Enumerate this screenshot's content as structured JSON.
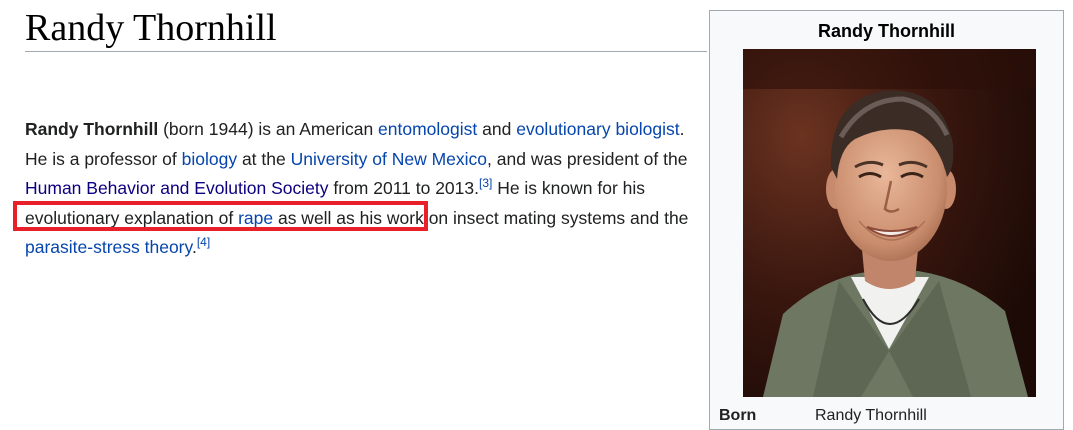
{
  "article": {
    "title": "Randy Thornhill",
    "lead": {
      "subject": "Randy Thornhill",
      "t1": " (born 1944) is an American ",
      "link_entomologist": "entomologist",
      "t2": " and ",
      "link_evolutionary_biologist": "evolutionary biologist",
      "t3": ". He is a professor of ",
      "link_biology": "biology",
      "t4": " at the ",
      "link_unm": "University of New Mexico",
      "t5": ", and was president of the ",
      "link_hbes": "Human Behavior and Evolution Society",
      "t6": " from 2011 to 2013.",
      "ref3": "[3]",
      "t7": " He is known for his evolutionary explanation of ",
      "link_rape": "rape",
      "t8": " as well as his work on insect mating systems and the ",
      "link_parasite": "parasite-stress theory",
      "t9": ".",
      "ref4": "[4]"
    }
  },
  "infobox": {
    "title": "Randy Thornhill",
    "photo_alt": "Photo of Randy Thornhill",
    "rows": [
      {
        "label": "Born",
        "value": "Randy Thornhill"
      }
    ]
  },
  "annotation": {
    "highlight_color": "#e8202a"
  },
  "colors": {
    "link": "#0645ad",
    "visited_link": "#0b0080",
    "text": "#202122",
    "border": "#a2a9b1"
  }
}
